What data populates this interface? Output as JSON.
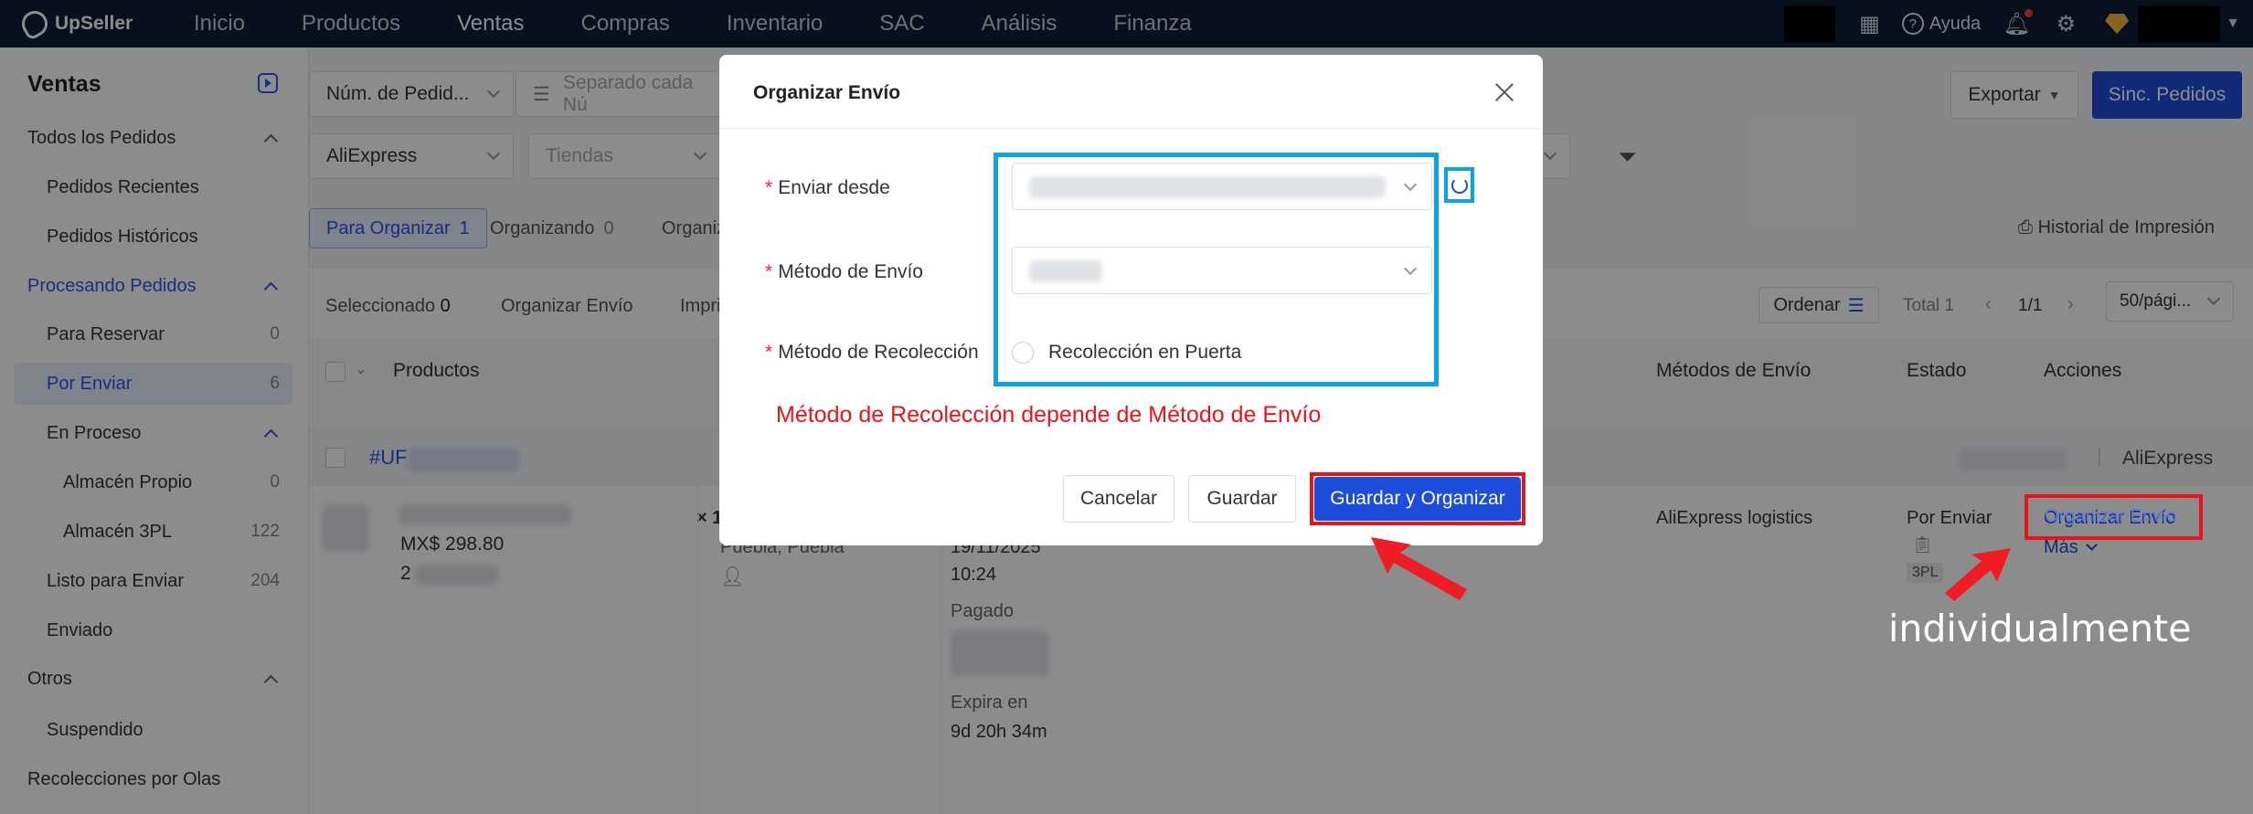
{
  "app": {
    "brand": "UpSeller",
    "nav": [
      "Inicio",
      "Productos",
      "Ventas",
      "Compras",
      "Inventario",
      "SAC",
      "Análisis",
      "Finanza"
    ],
    "nav_active": "Ventas",
    "help_label": "Ayuda"
  },
  "sidebar": {
    "title": "Ventas",
    "items": [
      {
        "label": "Todos los Pedidos",
        "count": ""
      },
      {
        "label": "Pedidos Recientes",
        "count": ""
      },
      {
        "label": "Pedidos Históricos",
        "count": ""
      },
      {
        "label": "Procesando Pedidos",
        "count": ""
      },
      {
        "label": "Para Reservar",
        "count": "0"
      },
      {
        "label": "Por Enviar",
        "count": "6"
      },
      {
        "label": "En Proceso",
        "count": ""
      },
      {
        "label": "Almacén Propio",
        "count": "0"
      },
      {
        "label": "Almacén 3PL",
        "count": "122"
      },
      {
        "label": "Listo para Enviar",
        "count": "204"
      },
      {
        "label": "Enviado",
        "count": ""
      },
      {
        "label": "Otros",
        "count": ""
      },
      {
        "label": "Suspendido",
        "count": ""
      },
      {
        "label": "Recolecciones por Olas",
        "count": ""
      }
    ]
  },
  "filters": {
    "search_type": "Núm. de Pedid...",
    "search_placeholder": "Separado cada Nú",
    "platform": "AliExpress",
    "store_placeholder": "Tiendas",
    "partial_select": "as",
    "export_label": "Exportar",
    "sync_label": "Sinc. Pedidos"
  },
  "tabs": [
    {
      "label": "Para Organizar",
      "count": "1"
    },
    {
      "label": "Organizando",
      "count": "0"
    },
    {
      "label": "Organiz",
      "count": ""
    }
  ],
  "print_history": "Historial de Impresión",
  "toolbar": {
    "selected_label": "Seleccionado",
    "selected_count": "0",
    "arrange_label": "Organizar Envío",
    "print_partial": "Impri",
    "sort_label": "Ordenar",
    "total": "Total 1",
    "page": "1/1",
    "per_page": "50/pági..."
  },
  "table": {
    "headers": {
      "products": "Productos",
      "shipping": "Métodos de Envío",
      "status": "Estado",
      "actions": "Acciones"
    },
    "order": {
      "id_prefix": "#UF",
      "platform": "AliExpress",
      "price": "MX$ 298.80",
      "qty": "2",
      "mult": "× 1",
      "location": "Puebla, Puebla",
      "created_partial": "gado",
      "created_date": "19/11/2025",
      "created_time": "10:24",
      "paid_label": "Pagado",
      "expire_label": "Expira en",
      "expire_value": "9d 20h 34m",
      "shipping_method": "AliExpress logistics",
      "status": "Por Enviar",
      "badge": "3PL",
      "action_primary": "Organizar Envío",
      "action_more": "Más"
    }
  },
  "modal": {
    "title": "Organizar Envío",
    "field_ship_from": "Enviar desde",
    "field_ship_method": "Método de Envío",
    "field_pickup": "Método de Recolección",
    "pickup_option": "Recolección en Puerta",
    "note": "Método de Recolección depende de Método de Envío",
    "cancel": "Cancelar",
    "save": "Guardar",
    "save_arrange": "Guardar y Organizar"
  },
  "annotation": "individualmente",
  "colors": {
    "primary": "#1e4ddb",
    "topbar": "#0f1e35",
    "highlight_blue": "#0da3e0",
    "highlight_red": "#e8141c"
  }
}
